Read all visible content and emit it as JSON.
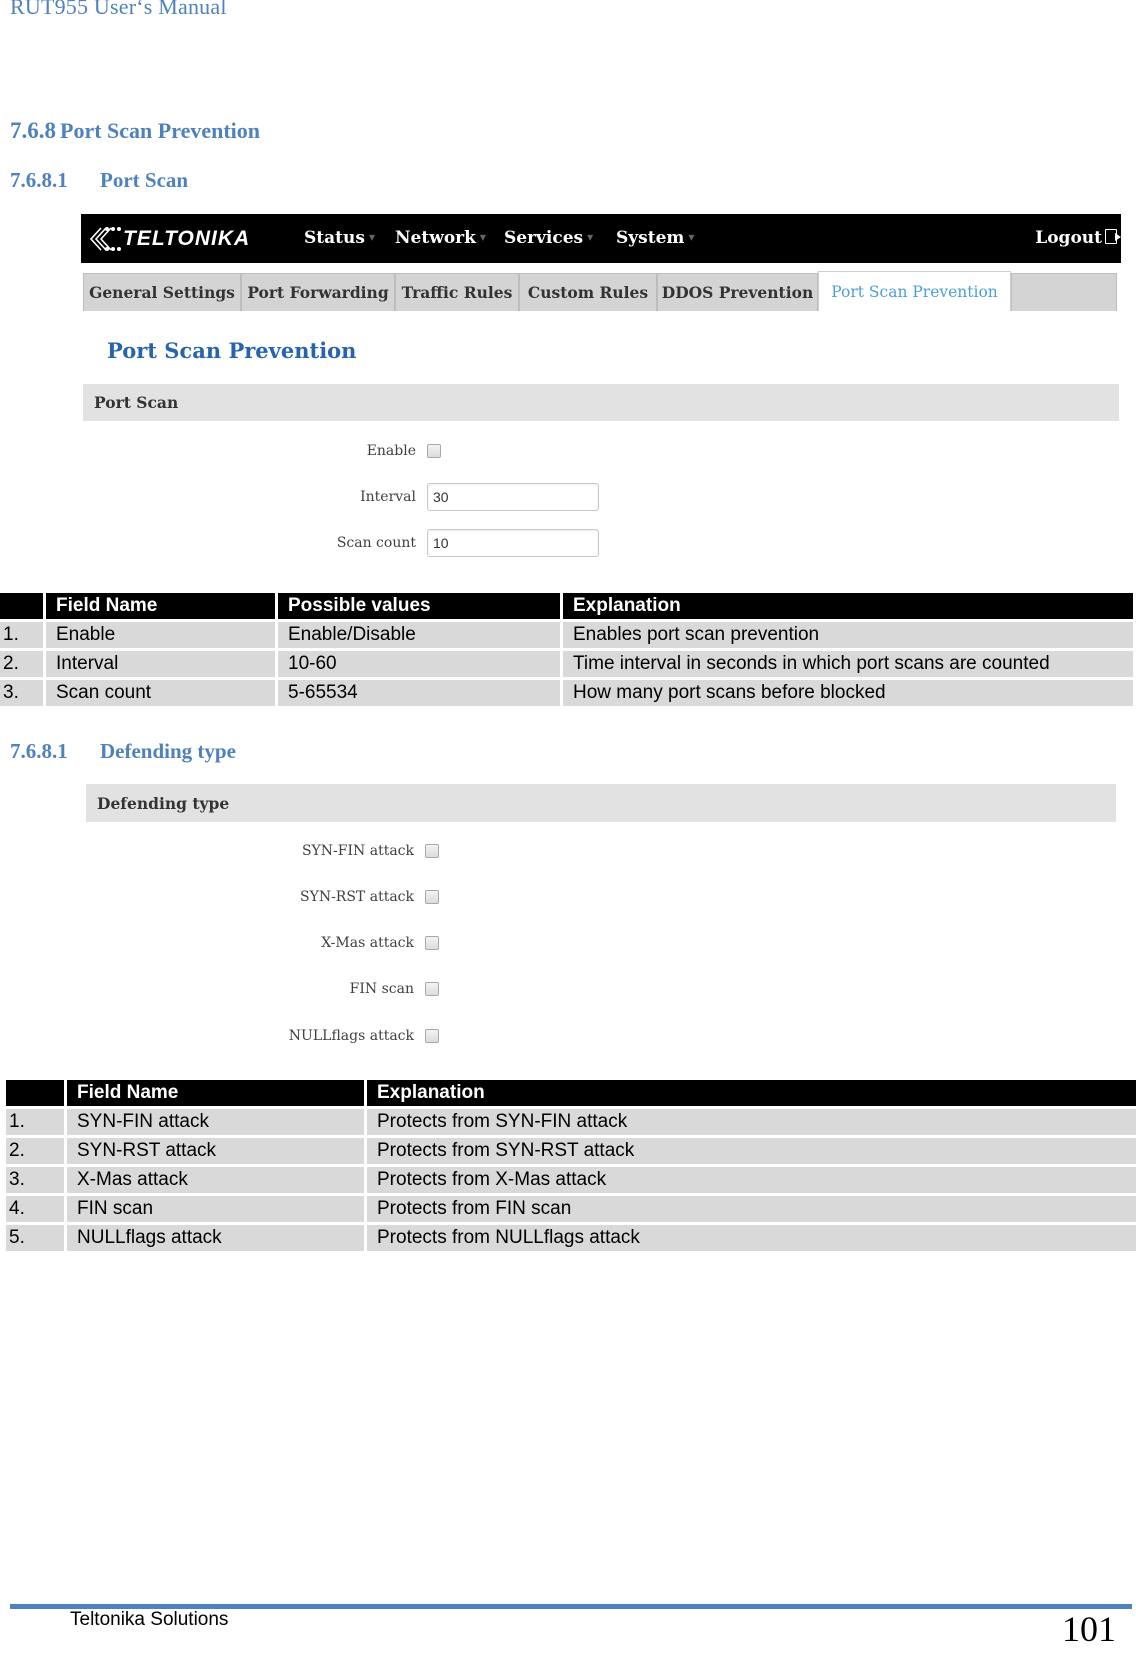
{
  "header": {
    "running_title": "RUT955 User‘s Manual"
  },
  "section": {
    "number": "7.6.8",
    "title": "Port Scan Prevention"
  },
  "subsection_port_scan": {
    "number": "7.6.8.1",
    "title": "Port Scan"
  },
  "subsection_defending": {
    "number": "7.6.8.1",
    "title": "Defending type"
  },
  "screenshot": {
    "brand": "TELTONIKA",
    "nav": [
      {
        "label": "Status"
      },
      {
        "label": "Network"
      },
      {
        "label": "Services"
      },
      {
        "label": "System"
      }
    ],
    "logout_label": "Logout",
    "tabs": [
      {
        "label": "General Settings",
        "active": false
      },
      {
        "label": "Port Forwarding",
        "active": false
      },
      {
        "label": "Traffic Rules",
        "active": false
      },
      {
        "label": "Custom Rules",
        "active": false
      },
      {
        "label": "DDOS Prevention",
        "active": false
      },
      {
        "label": "Port Scan Prevention",
        "active": true
      }
    ],
    "page_title": "Port Scan Prevention",
    "port_scan_section": "Port Scan",
    "fields": {
      "enable": {
        "label": "Enable",
        "checked": false
      },
      "interval": {
        "label": "Interval",
        "value": "30"
      },
      "scan_count": {
        "label": "Scan count",
        "value": "10"
      }
    },
    "defending_section": "Defending type",
    "defending_options": [
      {
        "label": "SYN-FIN attack",
        "checked": false
      },
      {
        "label": "SYN-RST attack",
        "checked": false
      },
      {
        "label": "X-Mas attack",
        "checked": false
      },
      {
        "label": "FIN scan",
        "checked": false
      },
      {
        "label": "NULLflags attack",
        "checked": false
      }
    ]
  },
  "table_port_scan": {
    "headers": [
      "",
      "Field Name",
      "Possible values",
      "Explanation"
    ],
    "rows": [
      [
        "1.",
        "Enable",
        "Enable/Disable",
        "Enables port scan prevention"
      ],
      [
        "2.",
        "Interval",
        "10-60",
        "Time interval in seconds in which port scans are counted"
      ],
      [
        "3.",
        "Scan count",
        "5-65534",
        "How many port scans before blocked"
      ]
    ]
  },
  "table_defending": {
    "headers": [
      "",
      "Field Name",
      "Explanation"
    ],
    "rows": [
      [
        "1.",
        "SYN-FIN attack",
        "Protects from SYN-FIN attack"
      ],
      [
        "2.",
        "SYN-RST attack",
        "Protects from SYN-RST attack"
      ],
      [
        "3.",
        "X-Mas attack",
        "Protects from X-Mas attack"
      ],
      [
        "4.",
        "FIN scan",
        "Protects from FIN scan"
      ],
      [
        "5.",
        "NULLflags attack",
        "Protects from NULLflags attack"
      ]
    ]
  },
  "footer": {
    "company": "Teltonika Solutions",
    "page_number": "101"
  },
  "colors": {
    "heading_blue": "#4f81bd",
    "title_blue": "#2864ae",
    "active_tab": "#4c9fd8"
  }
}
